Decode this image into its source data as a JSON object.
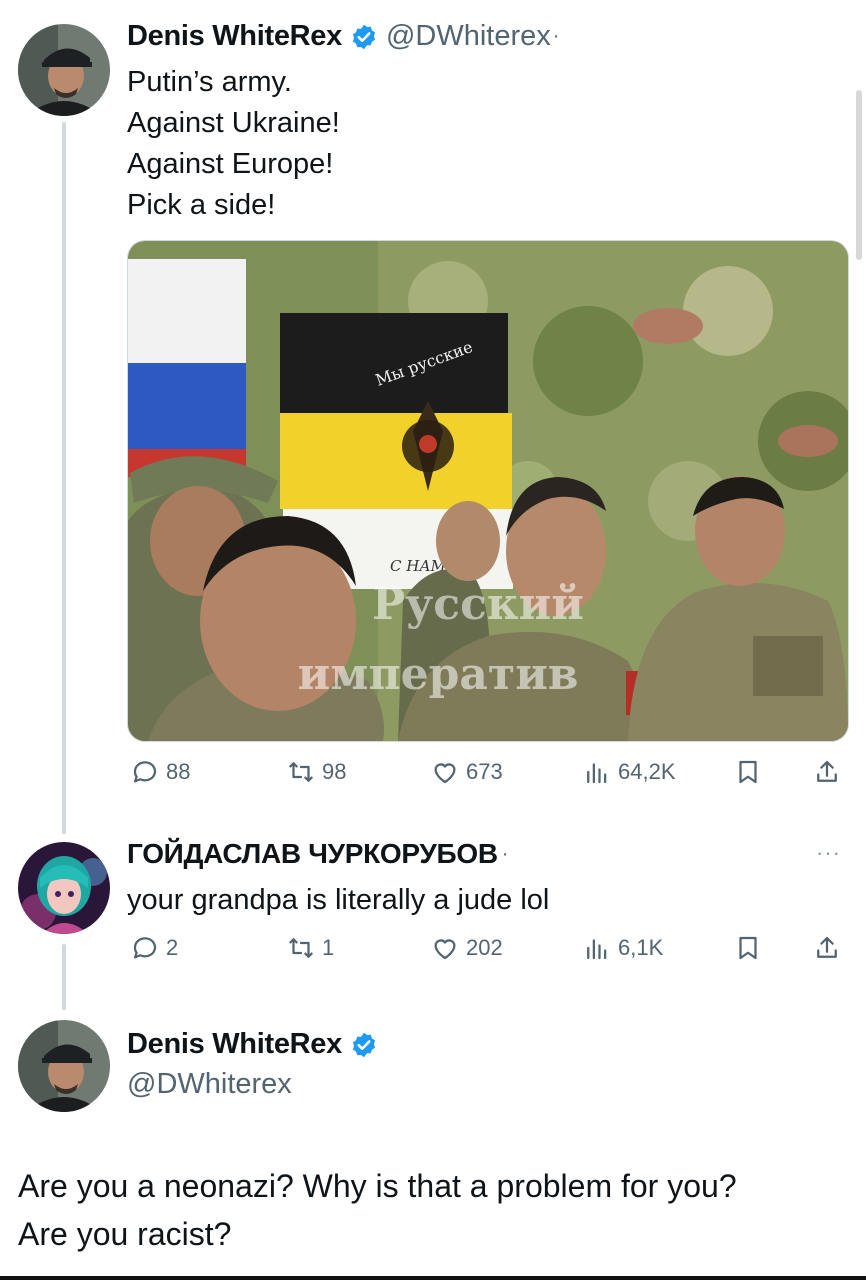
{
  "tweet1": {
    "name": "Denis WhiteRex",
    "handle": "@DWhiterex",
    "dot": "·",
    "lines": [
      "Putin’s army.",
      "Against Ukraine!",
      "Against Europe!",
      "Pick a side!"
    ],
    "image_overlay": {
      "flag_text_top": "Мы русские",
      "flag_text_bottom": "С НАМИ",
      "watermark_line1": "Русский",
      "watermark_line2": "императив"
    },
    "replies": "88",
    "reposts": "98",
    "likes": "673",
    "views": "64,2K"
  },
  "reply": {
    "name": "ГОЙДАСЛАВ ЧУРКОРУБОВ",
    "dot": "·",
    "text": "your grandpa is literally a jude lol",
    "replies": "2",
    "reposts": "1",
    "likes": "202",
    "views": "6,1K",
    "more": "···"
  },
  "tweet2": {
    "name": "Denis WhiteRex",
    "handle": "@DWhiterex",
    "lines": [
      "Are you a neonazi? Why is that a problem for you?",
      "Are you racist?"
    ]
  },
  "colors": {
    "verified": "#1d9bf0",
    "muted": "#536471",
    "thread_line": "#cfd9de"
  },
  "icons": [
    "reply-icon",
    "repost-icon",
    "like-icon",
    "views-icon",
    "bookmark-icon",
    "share-icon",
    "verified-badge-icon",
    "more-icon"
  ]
}
